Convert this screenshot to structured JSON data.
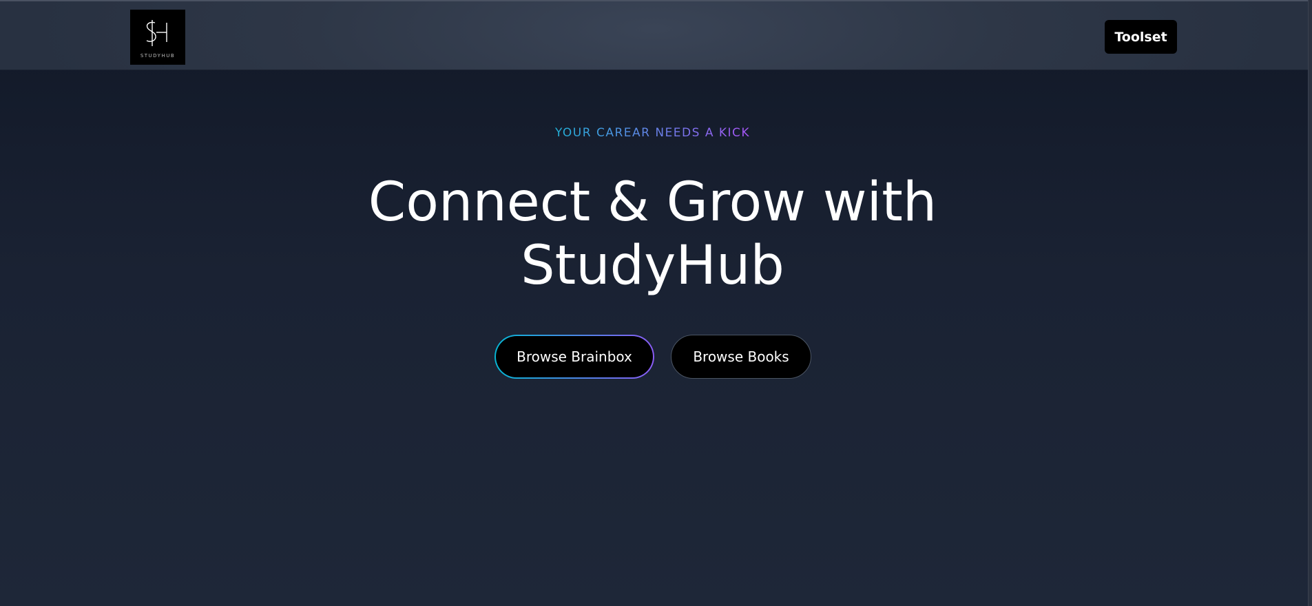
{
  "header": {
    "logo_caption": "STUDYHUB",
    "toolset_label": "Toolset"
  },
  "hero": {
    "kicker": "YOUR CAREAR NEEDS A KICK",
    "headline_line1": "Connect & Grow with",
    "headline_line2": "StudyHub",
    "primary_cta": "Browse Brainbox",
    "secondary_cta": "Browse Books"
  },
  "colors": {
    "background_top": "#111827",
    "background_bottom": "#1e2738",
    "header_bg": "#2e3747",
    "button_bg": "#000000",
    "accent_gradient_start": "#06b6d4",
    "accent_gradient_end": "#8b5cf6"
  },
  "icons": {
    "logo": "studyhub-sh-monogram"
  }
}
